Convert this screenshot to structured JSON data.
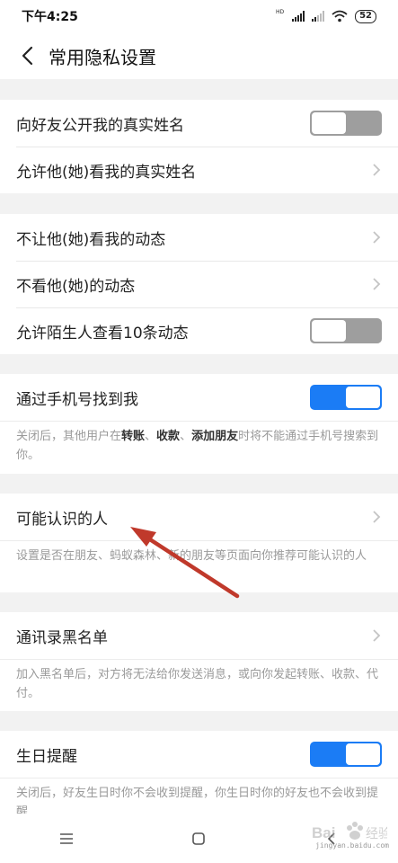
{
  "status_bar": {
    "time": "下午4:25",
    "battery": "52",
    "hd": "HD"
  },
  "header": {
    "title": "常用隐私设置",
    "back_icon": "chevron-left-icon"
  },
  "group1": {
    "real_name_public": {
      "label": "向好友公开我的真实姓名",
      "enabled": false
    },
    "allow_see_real_name": {
      "label": "允许他(她)看我的真实姓名"
    }
  },
  "group2": {
    "hide_my_moments": {
      "label": "不让他(她)看我的动态"
    },
    "dont_see_moments": {
      "label": "不看他(她)的动态"
    },
    "stranger_ten_posts": {
      "label": "允许陌生人查看10条动态",
      "enabled": false
    }
  },
  "group3": {
    "find_by_phone": {
      "label": "通过手机号找到我",
      "enabled": true
    },
    "note": {
      "prefix": "关闭后，其他用户在",
      "bold1": "转账",
      "sep1": "、",
      "bold2": "收款",
      "sep2": "、",
      "bold3": "添加朋友",
      "suffix": "时将不能通过手机号搜索到你。"
    }
  },
  "group4": {
    "maybe_known": {
      "label": "可能认识的人"
    },
    "note": "设置是否在朋友、蚂蚁森林、新的朋友等页面向你推荐可能认识的人"
  },
  "group5": {
    "contacts_blacklist": {
      "label": "通讯录黑名单"
    },
    "note": "加入黑名单后，对方将无法给你发送消息，或向你发起转账、收款、代付。"
  },
  "group6": {
    "birthday_reminder": {
      "label": "生日提醒",
      "enabled": true
    },
    "note": "关闭后，好友生日时你不会收到提醒，你生日时你的好友也不会收到提醒"
  },
  "annotation": {
    "color": "#c0392b"
  },
  "watermark": {
    "text": "jingyan.baidu.com",
    "brand": "Baidu 经验"
  },
  "colors": {
    "accent": "#1b7cf5",
    "toggle_off": "#9e9e9e",
    "background": "#f2f2f2"
  }
}
